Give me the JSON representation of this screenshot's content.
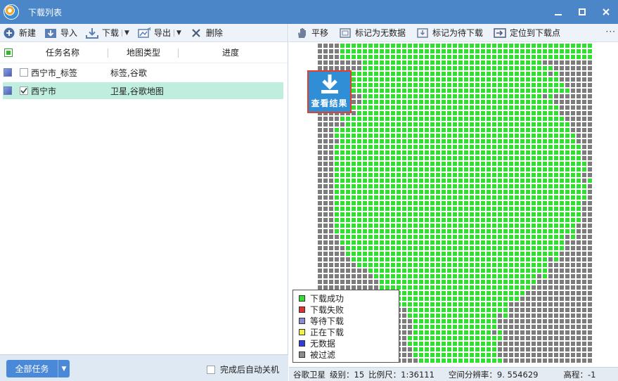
{
  "window": {
    "title": "下载列表"
  },
  "left_toolbar": {
    "new_label": "新建",
    "import_label": "导入",
    "download_label": "下载",
    "export_label": "导出",
    "delete_label": "删除"
  },
  "task_list": {
    "columns": [
      "任务名称",
      "地图类型",
      "进度"
    ],
    "rows": [
      {
        "name": "西宁市_标签",
        "type": "标签,谷歌",
        "checked": false,
        "selected": false
      },
      {
        "name": "西宁市",
        "type": "卫星,谷歌地图",
        "checked": true,
        "selected": true
      }
    ]
  },
  "footer": {
    "all_tasks_label": "全部任务",
    "auto_shutdown_label": "完成后自动关机"
  },
  "right_toolbar": {
    "pan_label": "平移",
    "mark_no_data_label": "标记为无数据",
    "mark_pending_label": "标记为待下载",
    "locate_label": "定位到下载点",
    "more_label": "···"
  },
  "map": {
    "view_result_label": "查看结果",
    "legend": [
      {
        "label": "下载成功",
        "color": "#33dd33"
      },
      {
        "label": "下载失败",
        "color": "#e03030"
      },
      {
        "label": "等待下载",
        "color": "#8a8ad8"
      },
      {
        "label": "正在下载",
        "color": "#f0f040"
      },
      {
        "label": "无数据",
        "color": "#2c3ce0"
      },
      {
        "label": "被过滤",
        "color": "#8c8c8c"
      }
    ],
    "tile_colors": {
      "success": "#33dd33",
      "filtered": "#7c7c7c",
      "grid": "#ffffff"
    }
  },
  "status": {
    "source": "谷歌卫星",
    "level": "级别：15",
    "scale": "比例尺：1:36111",
    "resolution": "空间分辨率：9. 554629",
    "elevation": "高程：-1"
  },
  "colors": {
    "titlebar": "#4a86c8",
    "accent": "#4a88d8",
    "selected_row": "#bfeedf"
  }
}
